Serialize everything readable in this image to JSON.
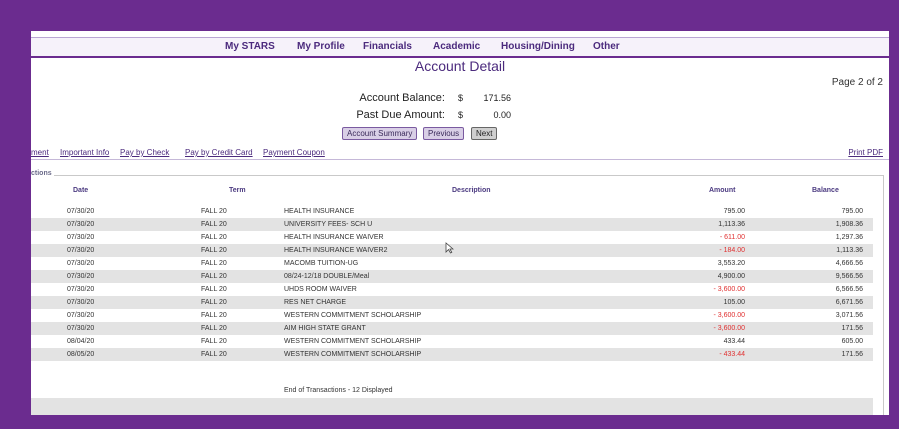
{
  "nav": [
    "My STARS",
    "My Profile",
    "Financials",
    "Academic",
    "Housing/Dining",
    "Other"
  ],
  "title": "Account Detail",
  "page_indicator": "Page 2 of 2",
  "account_balance_label": "Account Balance:",
  "account_balance_currency": "$",
  "account_balance_value": "171.56",
  "past_due_label": "Past Due Amount:",
  "past_due_currency": "$",
  "past_due_value": "0.00",
  "buttons": [
    "Account Summary",
    "Previous",
    "Next"
  ],
  "links": [
    "ment",
    "Important Info",
    "Pay by Check",
    "Pay by Credit Card",
    "Payment Coupon"
  ],
  "print_label": "Print PDF",
  "section_label": "ctions",
  "columns": [
    "Date",
    "Term",
    "Description",
    "Amount",
    "Balance"
  ],
  "rows": [
    {
      "date": "07/30/20",
      "term": "FALL 20",
      "desc": "HEALTH INSURANCE",
      "amount": "795.00",
      "balance": "795.00",
      "negative": false
    },
    {
      "date": "07/30/20",
      "term": "FALL 20",
      "desc": "UNIVERSITY FEES- SCH U",
      "amount": "1,113.36",
      "balance": "1,908.36",
      "negative": false
    },
    {
      "date": "07/30/20",
      "term": "FALL 20",
      "desc": "HEALTH INSURANCE WAIVER",
      "amount": "- 611.00",
      "balance": "1,297.36",
      "negative": true
    },
    {
      "date": "07/30/20",
      "term": "FALL 20",
      "desc": "HEALTH INSURANCE WAIVER2",
      "amount": "- 184.00",
      "balance": "1,113.36",
      "negative": true
    },
    {
      "date": "07/30/20",
      "term": "FALL 20",
      "desc": "MACOMB TUITION-UG",
      "amount": "3,553.20",
      "balance": "4,666.56",
      "negative": false
    },
    {
      "date": "07/30/20",
      "term": "FALL 20",
      "desc": "08/24-12/18 DOUBLE/Meal",
      "amount": "4,900.00",
      "balance": "9,566.56",
      "negative": false
    },
    {
      "date": "07/30/20",
      "term": "FALL 20",
      "desc": "UHDS ROOM WAIVER",
      "amount": "- 3,600.00",
      "balance": "6,566.56",
      "negative": true
    },
    {
      "date": "07/30/20",
      "term": "FALL 20",
      "desc": "RES NET CHARGE",
      "amount": "105.00",
      "balance": "6,671.56",
      "negative": false
    },
    {
      "date": "07/30/20",
      "term": "FALL 20",
      "desc": "WESTERN COMMITMENT SCHOLARSHIP",
      "amount": "- 3,600.00",
      "balance": "3,071.56",
      "negative": true
    },
    {
      "date": "07/30/20",
      "term": "FALL 20",
      "desc": "AIM HIGH STATE GRANT",
      "amount": "- 3,600.00",
      "balance": "171.56",
      "negative": true
    },
    {
      "date": "08/04/20",
      "term": "FALL 20",
      "desc": "WESTERN COMMITMENT SCHOLARSHIP",
      "amount": "433.44",
      "balance": "605.00",
      "negative": false
    },
    {
      "date": "08/05/20",
      "term": "FALL 20",
      "desc": "WESTERN COMMITMENT SCHOLARSHIP",
      "amount": "- 433.44",
      "balance": "171.56",
      "negative": true
    }
  ],
  "end_text": "End of Transactions - 12 Displayed",
  "colors": {
    "frame": "#6b2c8f",
    "nav_text": "#4b2a7d",
    "negative": "#e03030",
    "row_shade": "#e3e3e3"
  }
}
